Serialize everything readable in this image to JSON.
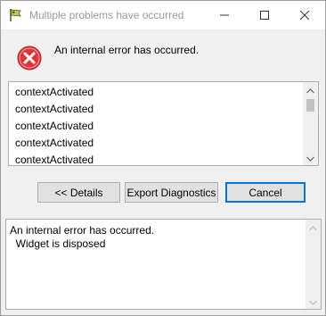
{
  "window": {
    "title": "Multiple problems have occurred",
    "app_icon": "eclipse-flag-icon",
    "controls": {
      "minimize": "minimize-icon",
      "maximize": "maximize-icon",
      "close": "close-icon"
    }
  },
  "header": {
    "icon": "error-icon",
    "message": "An internal error has occurred."
  },
  "problems": {
    "items": [
      "contextActivated",
      "contextActivated",
      "contextActivated",
      "contextActivated",
      "contextActivated"
    ]
  },
  "buttons": {
    "details": "<< Details",
    "export": "Export Diagnostics",
    "cancel": "Cancel"
  },
  "details": {
    "text": "An internal error has occurred.\n  Widget is disposed"
  },
  "colors": {
    "error_red": "#e0343a",
    "focus_blue": "#0078d7"
  }
}
